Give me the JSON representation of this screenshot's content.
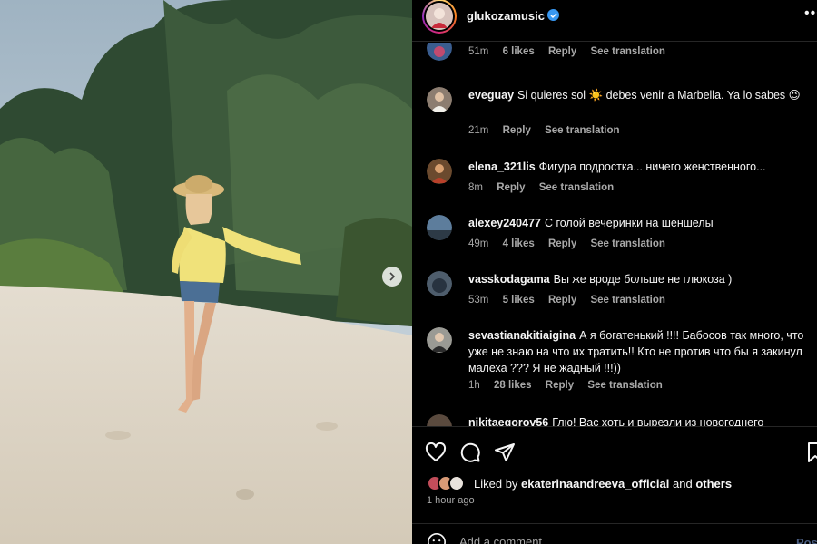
{
  "post": {
    "username": "glukozamusic",
    "liked_by_prefix": "Liked by",
    "liked_by_user": "ekaterinaandreeva_official",
    "liked_by_and": "and",
    "liked_by_others": "others",
    "time_ago": "1 hour ago",
    "add_comment_placeholder": "Add a comment...",
    "post_label": "Post"
  },
  "comments": [
    {
      "user": "",
      "text": "",
      "time": "51m",
      "likes": "6 likes",
      "reply": "Reply",
      "translate": "See translation"
    },
    {
      "user": "eveguay",
      "text": "Si quieres sol ☀️ debes venir a Marbella. Ya lo sabes 😉",
      "time": "21m",
      "likes": "",
      "reply": "Reply",
      "translate": "See translation"
    },
    {
      "user": "elena_321lis",
      "text": "Фигура подростка... ничего женственного...",
      "time": "8m",
      "likes": "",
      "reply": "Reply",
      "translate": "See translation"
    },
    {
      "user": "alexey240477",
      "text": "С голой вечеринки на шеншелы",
      "time": "49m",
      "likes": "4 likes",
      "reply": "Reply",
      "translate": "See translation"
    },
    {
      "user": "vasskodagama",
      "text": "Вы же вроде больше не глюкоза )",
      "time": "53m",
      "likes": "5 likes",
      "reply": "Reply",
      "translate": "See translation"
    },
    {
      "user": "sevastianakitiaigina",
      "text": "А я богатенький !!!! Бабосов так много, что уже не знаю на что их тратить!! Кто не против что бы я закинул малеха ??? Я не жадный !!!))",
      "time": "1h",
      "likes": "28 likes",
      "reply": "Reply",
      "translate": "See translation"
    },
    {
      "user": "nikitaegorov56",
      "text": "Глю! Вас хоть и вырезли из новогоднего",
      "time": "",
      "likes": "",
      "reply": "",
      "translate": ""
    }
  ],
  "colors": {
    "verified": "#3897f0",
    "muted": "#a8a8a8",
    "post_disabled": "#4a5d80"
  },
  "icons": [
    "chevron-right-icon",
    "verified-icon",
    "more-icon",
    "heart-icon",
    "comment-icon",
    "share-icon",
    "bookmark-icon",
    "emoji-icon"
  ]
}
